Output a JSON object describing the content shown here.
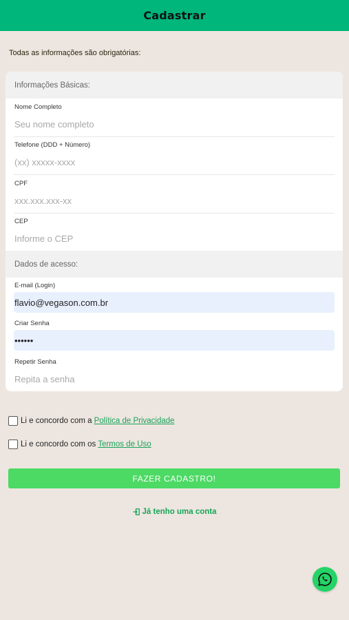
{
  "header": {
    "title": "Cadastrar"
  },
  "notice": "Todas as informações são obrigatórias:",
  "sections": {
    "basic": "Informações Básicas:",
    "access": "Dados de acesso:"
  },
  "fields": {
    "name": {
      "label": "Nome Completo",
      "placeholder": "Seu nome completo",
      "value": ""
    },
    "phone": {
      "label": "Telefone (DDD + Número)",
      "placeholder": "(xx) xxxxx-xxxx",
      "value": ""
    },
    "cpf": {
      "label": "CPF",
      "placeholder": "xxx.xxx.xxx-xx",
      "value": ""
    },
    "cep": {
      "label": "CEP",
      "placeholder": "Informe o CEP",
      "value": ""
    },
    "email": {
      "label": "E-mail (Login)",
      "placeholder": "",
      "value": "flavio@vegason.com.br"
    },
    "password": {
      "label": "Criar Senha",
      "placeholder": "",
      "value": "123456"
    },
    "password_repeat": {
      "label": "Repetir Senha",
      "placeholder": "Repita a senha",
      "value": ""
    }
  },
  "consents": {
    "privacy": {
      "text": "Li e concordo com a",
      "link": "Política de Privacidade",
      "checked": false
    },
    "terms": {
      "text": "Li e concordo com os",
      "link": "Termos de Uso",
      "checked": false
    }
  },
  "actions": {
    "submit": "FAZER CADASTRO!",
    "login": "Já tenho uma conta"
  },
  "icons": {
    "login": "sign-in-icon",
    "chat": "whatsapp-icon"
  },
  "colors": {
    "header": "#00b67a",
    "submit": "#4cd964",
    "link": "#1aa25a",
    "whatsapp": "#25d366"
  }
}
